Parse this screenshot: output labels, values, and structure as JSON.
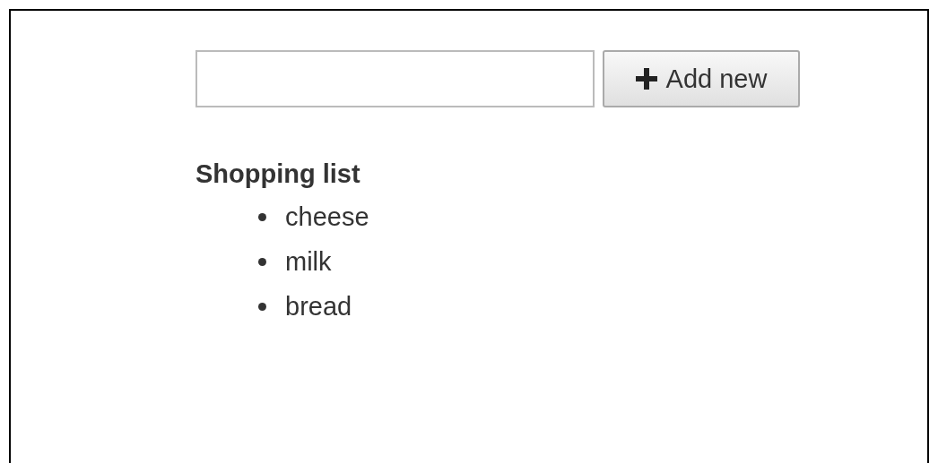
{
  "add_form": {
    "button": "Add new"
  },
  "list": {
    "title": "Shopping list",
    "items": [
      "cheese",
      "milk",
      "bread"
    ]
  }
}
